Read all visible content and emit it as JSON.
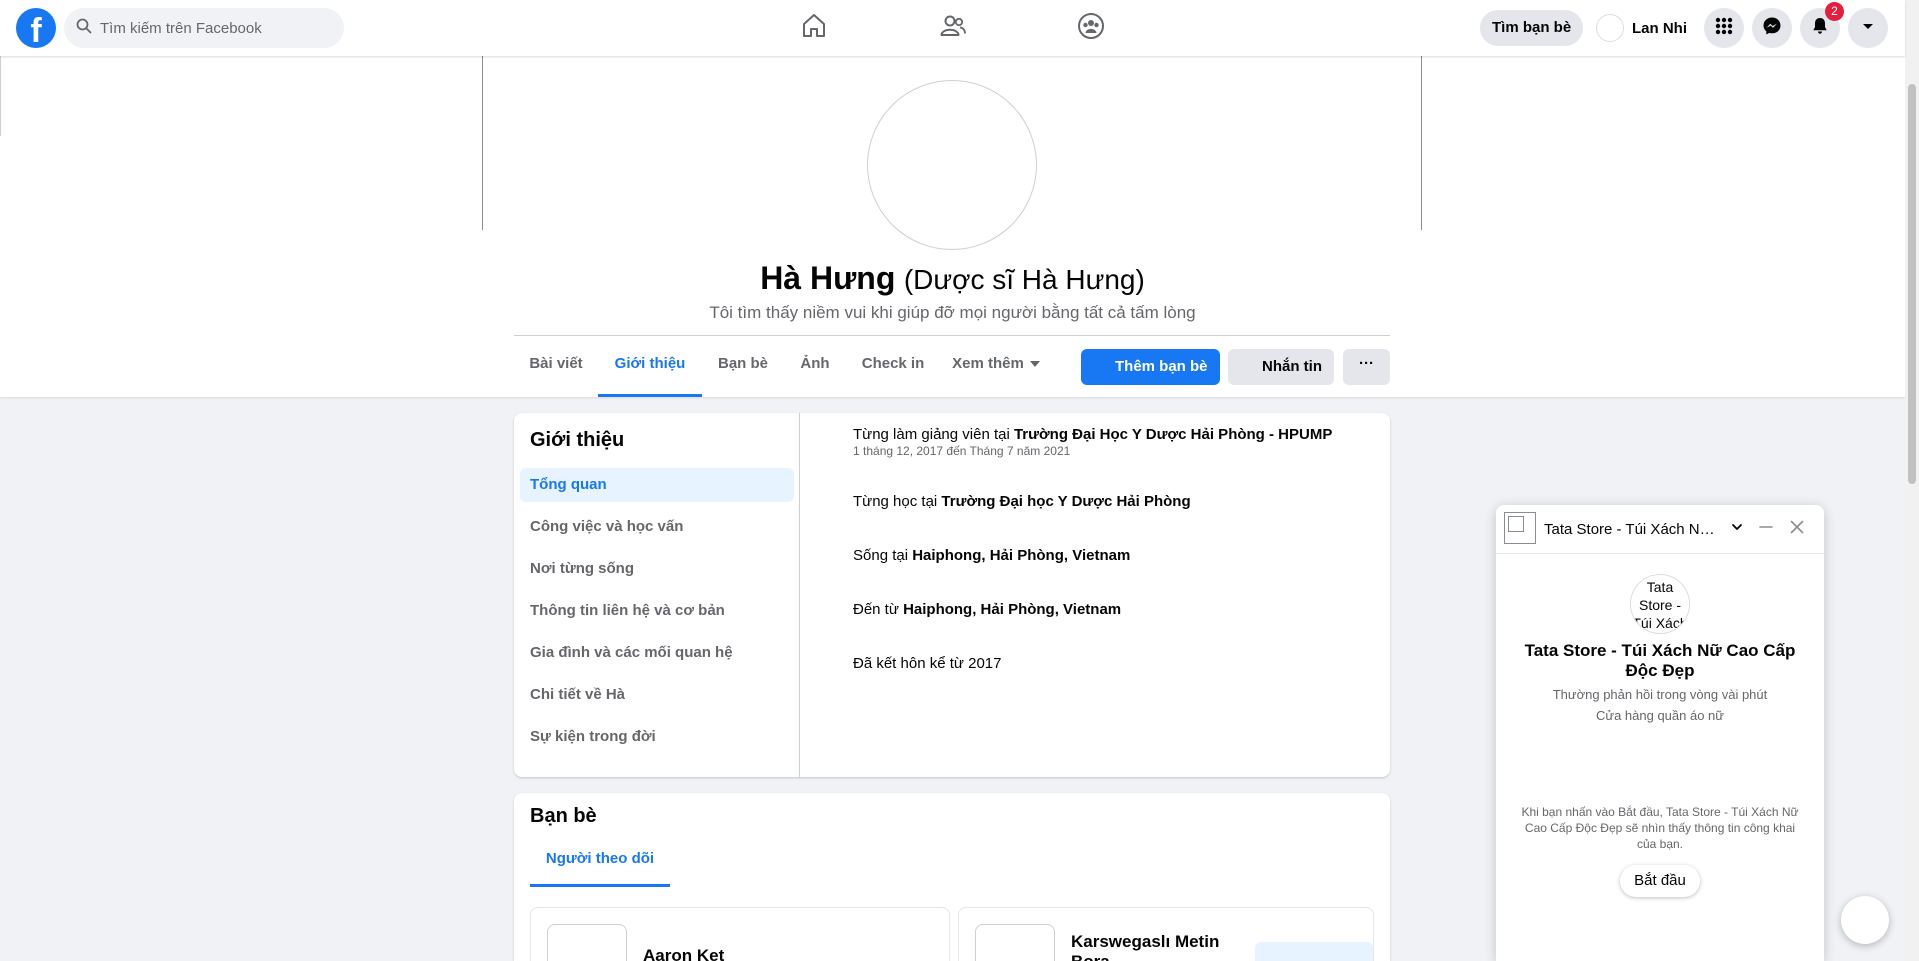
{
  "topbar": {
    "logo": "f",
    "search_placeholder": "Tìm kiếm trên Facebook",
    "find_friends": "Tìm bạn bè",
    "me_name": "Lan Nhi",
    "notif_count": "2"
  },
  "profile": {
    "name": "Hà Hưng",
    "alt_name": "(Dược sĩ Hà Hưng)",
    "bio": "Tôi tìm thấy niềm vui khi giúp đỡ mọi người bằng tất cả tấm lòng",
    "tabs": [
      {
        "label": "Bài viết"
      },
      {
        "label": "Giới thiệu"
      },
      {
        "label": "Bạn bè"
      },
      {
        "label": "Ảnh"
      },
      {
        "label": "Check in"
      },
      {
        "label": "Xem thêm"
      }
    ],
    "add_friend": "Thêm bạn bè",
    "message": "Nhắn tin",
    "more": "···"
  },
  "intro": {
    "title": "Giới thiệu",
    "nav": [
      {
        "label": "Tổng quan"
      },
      {
        "label": "Công việc và học vấn"
      },
      {
        "label": "Nơi từng sống"
      },
      {
        "label": "Thông tin liên hệ và cơ bản"
      },
      {
        "label": "Gia đình và các mối quan hệ"
      },
      {
        "label": "Chi tiết về Hà"
      },
      {
        "label": "Sự kiện trong đời"
      }
    ],
    "items": [
      {
        "prefix": "Từng làm giảng viên tại ",
        "bold": "Trường Đại Học Y Dược Hải Phòng - HPUMP",
        "sub": "1 tháng 12, 2017 đến Tháng 7 năm 2021"
      },
      {
        "prefix": "Từng học tại ",
        "bold": "Trường Đại học Y Dược Hải Phòng"
      },
      {
        "prefix": "Sống tại ",
        "bold": "Haiphong, Hải Phòng, Vietnam"
      },
      {
        "prefix": "Đến từ ",
        "bold": "Haiphong, Hải Phòng, Vietnam"
      },
      {
        "prefix": "Đã kết hôn kể từ 2017",
        "bold": ""
      }
    ]
  },
  "friends": {
    "title": "Bạn bè",
    "tab": "Người theo dõi",
    "list": [
      {
        "name": "Aaron Ket"
      },
      {
        "name": "Karswegaslı Metin Bora"
      }
    ]
  },
  "chat": {
    "title": "Tata Store - Túi Xách Nữ Cao Cấp Độc Đẹp",
    "avatar_alt": "Tata Store - Túi Xách",
    "page_name": "Tata Store - Túi Xách Nữ Cao Cấp Độc Đẹp",
    "response": "Thường phản hồi trong vòng vài phút",
    "category": "Cửa hàng quần áo nữ",
    "note": "Khi bạn nhấn vào Bắt đầu, Tata Store - Túi Xách Nữ Cao Cấp Độc Đẹp sẽ nhìn thấy thông tin công khai của bạn.",
    "start": "Bắt đầu"
  }
}
